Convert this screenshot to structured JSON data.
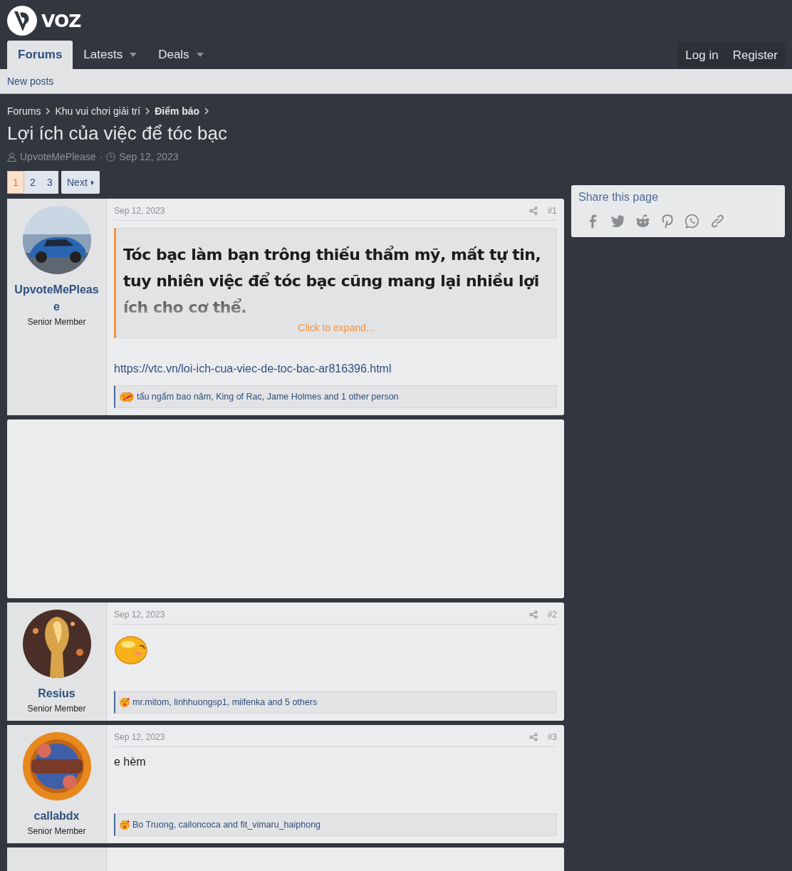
{
  "logo": {
    "text": "VOZ"
  },
  "nav": {
    "tabs": [
      {
        "label": "Forums",
        "selected": true,
        "has_menu": false
      },
      {
        "label": "Latests",
        "selected": false,
        "has_menu": true
      },
      {
        "label": "Deals",
        "selected": false,
        "has_menu": true
      }
    ],
    "account": [
      "Log in",
      "Register"
    ]
  },
  "subnav": [
    "New posts"
  ],
  "breadcrumbs": [
    {
      "label": "Forums",
      "current": false
    },
    {
      "label": "Khu vui chơi giải trí",
      "current": false
    },
    {
      "label": "Điểm báo",
      "current": true
    }
  ],
  "thread": {
    "title": "Lợi ích của việc để tóc bạc",
    "author": "UpvoteMePlease",
    "separator": "·",
    "date": "Sep 12, 2023"
  },
  "pagination": {
    "pages": [
      {
        "label": "1",
        "selected": true
      },
      {
        "label": "2",
        "selected": false
      },
      {
        "label": "3",
        "selected": false
      }
    ],
    "next": "Next"
  },
  "posts": [
    {
      "kind": "quote",
      "author": "UpvoteMePlease",
      "role": "Senior Member",
      "date": "Sep 12, 2023",
      "number": "#1",
      "quote": "Tóc bạc làm bạn trông thiếu thẩm mỹ, mất tự tin, tuy nhiên việc để tóc bạc cũng mang lại nhiều lợi ích cho cơ thể.",
      "expand": "Click to expand...",
      "link": "https://vtc.vn/loi-ich-cua-viec-de-toc-bac-ar816396.html",
      "reaction_icons": [
        {
          "kind": "love"
        },
        {
          "kind": "haha"
        }
      ],
      "reactions": "tẩu ngẩm bao năm, King of Rac, Jame Holmes and 1 other person"
    },
    {
      "kind": "ad"
    },
    {
      "kind": "smiley",
      "author": "Resius",
      "role": "Senior Member",
      "date": "Sep 12, 2023",
      "number": "#2",
      "reaction_icons": [
        {
          "kind": "love"
        }
      ],
      "reactions": "mr.mitom, linhhuongsp1, miifenka and 5 others"
    },
    {
      "kind": "text",
      "author": "callabdx",
      "role": "Senior Member",
      "date": "Sep 12, 2023",
      "number": "#3",
      "text": "e hèm",
      "reaction_icons": [
        {
          "kind": "love"
        }
      ],
      "reactions": "Bo Truong, cailoncoca and fit_vimaru_haiphong"
    },
    {
      "kind": "cut"
    }
  ],
  "share": {
    "title": "Share this page"
  }
}
